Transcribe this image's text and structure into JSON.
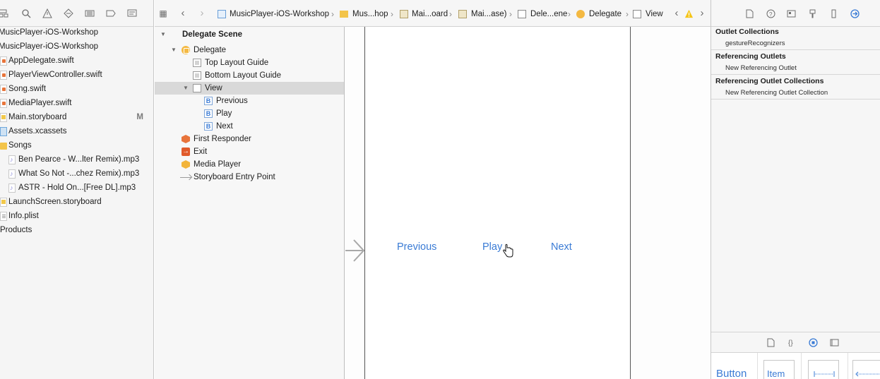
{
  "navigator": {
    "toolbar_icons": [
      "hierarchy-icon",
      "search-icon",
      "warning-icon",
      "test-diamond-icon",
      "debug-gauge-icon",
      "breakpoint-icon",
      "report-icon"
    ],
    "items": [
      {
        "label": "MusicPlayer-iOS-Workshop",
        "icon": "project"
      },
      {
        "label": "MusicPlayer-iOS-Workshop",
        "icon": "group"
      },
      {
        "label": "AppDelegate.swift",
        "icon": "swift"
      },
      {
        "label": "PlayerViewController.swift",
        "icon": "swift"
      },
      {
        "label": "Song.swift",
        "icon": "swift"
      },
      {
        "label": "MediaPlayer.swift",
        "icon": "swift"
      },
      {
        "label": "Main.storyboard",
        "icon": "storyboard",
        "mark": "M"
      },
      {
        "label": "Assets.xcassets",
        "icon": "assets"
      },
      {
        "label": "Songs",
        "icon": "folder"
      },
      {
        "label": "Ben Pearce - W...lter Remix).mp3",
        "icon": "mp3"
      },
      {
        "label": "What So Not -...chez Remix).mp3",
        "icon": "mp3"
      },
      {
        "label": "ASTR - Hold On...[Free DL].mp3",
        "icon": "mp3"
      },
      {
        "label": "LaunchScreen.storyboard",
        "icon": "storyboard"
      },
      {
        "label": "Info.plist",
        "icon": "plist"
      },
      {
        "label": "Products",
        "icon": "none"
      }
    ]
  },
  "jumpbar": {
    "path": [
      "MusicPlayer-iOS-Workshop",
      "Mus...hop",
      "Mai...oard",
      "Mai...ase)",
      "Dele...ene",
      "Delegate",
      "View"
    ]
  },
  "outline": {
    "items": [
      {
        "label": "Delegate Scene"
      },
      {
        "label": "Delegate"
      },
      {
        "label": "Top Layout Guide"
      },
      {
        "label": "Bottom Layout Guide"
      },
      {
        "label": "View"
      },
      {
        "label": "Previous"
      },
      {
        "label": "Play"
      },
      {
        "label": "Next"
      },
      {
        "label": "First Responder"
      },
      {
        "label": "Exit"
      },
      {
        "label": "Media Player"
      },
      {
        "label": "Storyboard Entry Point"
      }
    ],
    "button_glyph": "B"
  },
  "canvas": {
    "buttons": {
      "previous": "Previous",
      "play": "Play",
      "next": "Next"
    }
  },
  "inspector": {
    "sections": [
      {
        "title": "Outlet Collections",
        "items": [
          "gestureRecognizers"
        ]
      },
      {
        "title": "Referencing Outlets",
        "items": [
          "New Referencing Outlet"
        ]
      },
      {
        "title": "Referencing Outlet Collections",
        "items": [
          "New Referencing Outlet Collection"
        ]
      }
    ],
    "library": {
      "button_label": "Button",
      "item_label": "Item"
    }
  },
  "colors": {
    "accent": "#3a7bd5",
    "selection": "#d9d9d9",
    "warning": "#f5c518"
  }
}
